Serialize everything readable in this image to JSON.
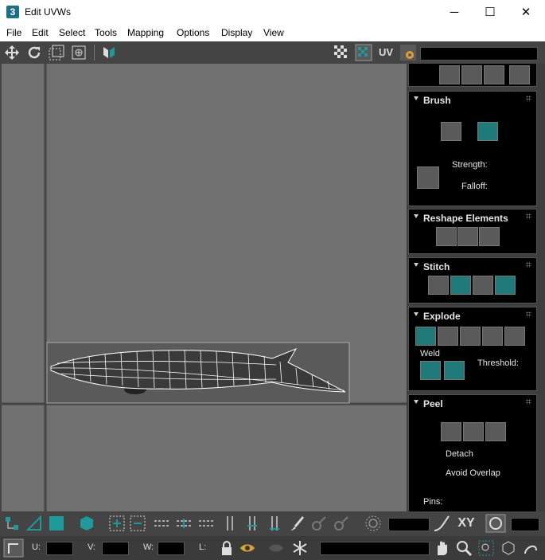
{
  "window": {
    "app_icon": "3",
    "title": "Edit UVWs",
    "minimize": "─",
    "maximize": "☐",
    "close": "✕"
  },
  "menu": [
    "File",
    "Edit",
    "Select",
    "Tools",
    "Mapping",
    "Options",
    "Display",
    "View"
  ],
  "toolbar": {
    "uv_label": "UV"
  },
  "panels": {
    "brush": {
      "title": "Brush",
      "strength": "Strength:",
      "falloff": "Falloff:"
    },
    "reshape": {
      "title": "Reshape Elements"
    },
    "stitch": {
      "title": "Stitch"
    },
    "explode": {
      "title": "Explode",
      "weld": "Weld",
      "threshold": "Threshold:"
    },
    "peel": {
      "title": "Peel",
      "detach": "Detach",
      "avoid_overlap": "Avoid Overlap",
      "pins": "Pins:"
    }
  },
  "bottom": {
    "xy": "XY",
    "u": "U:",
    "v": "V:",
    "w": "W:",
    "l": "L:"
  },
  "colors": {
    "accent": "#1f7a7a",
    "viewport": "#717171",
    "panel": "#000000"
  }
}
